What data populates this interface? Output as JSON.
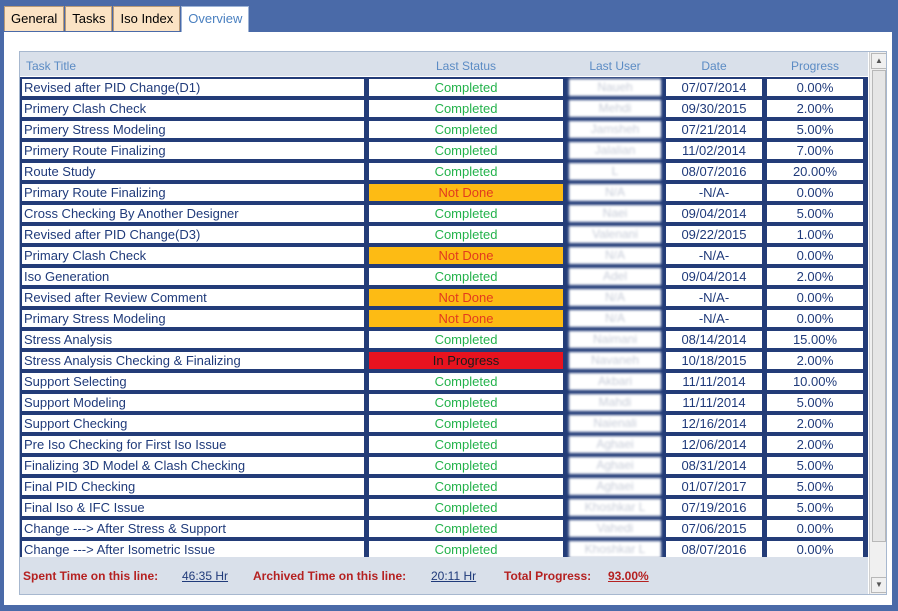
{
  "tabs": [
    {
      "label": "General"
    },
    {
      "label": "Tasks"
    },
    {
      "label": "Iso Index"
    },
    {
      "label": "Overview"
    }
  ],
  "columns": [
    "Task Title",
    "Last Status",
    "Last User",
    "Date",
    "Progress"
  ],
  "rows": [
    {
      "title": "Revised after PID Change(D1)",
      "status": "Completed",
      "status_type": "completed",
      "user": "Naueh",
      "date": "07/07/2014",
      "progress": "0.00%"
    },
    {
      "title": "Primery Clash Check",
      "status": "Completed",
      "status_type": "completed",
      "user": "Mehdi",
      "date": "09/30/2015",
      "progress": "2.00%"
    },
    {
      "title": "Primery Stress Modeling",
      "status": "Completed",
      "status_type": "completed",
      "user": "Jamsheh",
      "date": "07/21/2014",
      "progress": "5.00%"
    },
    {
      "title": "Primery Route Finalizing",
      "status": "Completed",
      "status_type": "completed",
      "user": "Jalalian",
      "date": "11/02/2014",
      "progress": "7.00%"
    },
    {
      "title": "Route Study",
      "status": "Completed",
      "status_type": "completed",
      "user": "L",
      "date": "08/07/2016",
      "progress": "20.00%"
    },
    {
      "title": "Primary Route Finalizing",
      "status": "Not Done",
      "status_type": "notdone",
      "user": "N/A",
      "date": "-N/A-",
      "progress": "0.00%"
    },
    {
      "title": "Cross Checking By Another Designer",
      "status": "Completed",
      "status_type": "completed",
      "user": "Naei",
      "date": "09/04/2014",
      "progress": "5.00%"
    },
    {
      "title": "Revised after PID Change(D3)",
      "status": "Completed",
      "status_type": "completed",
      "user": "Valenani",
      "date": "09/22/2015",
      "progress": "1.00%"
    },
    {
      "title": "Primary Clash Check",
      "status": "Not Done",
      "status_type": "notdone",
      "user": "N/A",
      "date": "-N/A-",
      "progress": "0.00%"
    },
    {
      "title": "Iso Generation",
      "status": "Completed",
      "status_type": "completed",
      "user": "Adel",
      "date": "09/04/2014",
      "progress": "2.00%"
    },
    {
      "title": "Revised after Review Comment",
      "status": "Not Done",
      "status_type": "notdone",
      "user": "N/A",
      "date": "-N/A-",
      "progress": "0.00%"
    },
    {
      "title": "Primary Stress Modeling",
      "status": "Not Done",
      "status_type": "notdone",
      "user": "N/A",
      "date": "-N/A-",
      "progress": "0.00%"
    },
    {
      "title": "Stress Analysis",
      "status": "Completed",
      "status_type": "completed",
      "user": "Naimani",
      "date": "08/14/2014",
      "progress": "15.00%"
    },
    {
      "title": "Stress Analysis Checking & Finalizing",
      "status": "In Progress",
      "status_type": "inprogress",
      "user": "Navaneh",
      "date": "10/18/2015",
      "progress": "2.00%"
    },
    {
      "title": "Support Selecting",
      "status": "Completed",
      "status_type": "completed",
      "user": "Akbari",
      "date": "11/11/2014",
      "progress": "10.00%"
    },
    {
      "title": "Support Modeling",
      "status": "Completed",
      "status_type": "completed",
      "user": "Mahdi",
      "date": "11/11/2014",
      "progress": "5.00%"
    },
    {
      "title": "Support Checking",
      "status": "Completed",
      "status_type": "completed",
      "user": "Naienali",
      "date": "12/16/2014",
      "progress": "2.00%"
    },
    {
      "title": "Pre Iso Checking for First Iso Issue",
      "status": "Completed",
      "status_type": "completed",
      "user": "Aghaei",
      "date": "12/06/2014",
      "progress": "2.00%"
    },
    {
      "title": "Finalizing 3D Model & Clash Checking",
      "status": "Completed",
      "status_type": "completed",
      "user": "Aghaei",
      "date": "08/31/2014",
      "progress": "5.00%"
    },
    {
      "title": "Final PID Checking",
      "status": "Completed",
      "status_type": "completed",
      "user": "Aghaei",
      "date": "01/07/2017",
      "progress": "5.00%"
    },
    {
      "title": "Final Iso & IFC Issue",
      "status": "Completed",
      "status_type": "completed",
      "user": "Khoshkar L",
      "date": "07/19/2016",
      "progress": "5.00%"
    },
    {
      "title": "Change ---> After Stress & Support",
      "status": "Completed",
      "status_type": "completed",
      "user": "Vahedi",
      "date": "07/06/2015",
      "progress": "0.00%"
    },
    {
      "title": "Change ---> After Isometric Issue",
      "status": "Completed",
      "status_type": "completed",
      "user": "Khoshkar L",
      "date": "08/07/2016",
      "progress": "0.00%"
    }
  ],
  "footer": {
    "spent_label": "Spent Time on this line:",
    "spent_value": "46:35 Hr",
    "archived_label": "Archived Time on this line:",
    "archived_value": "20:11 Hr",
    "progress_label": "Total Progress:",
    "progress_value": "93.00%"
  },
  "icons": {
    "scroll_up": "arrow-up-icon",
    "scroll_down": "arrow-down-icon"
  },
  "colors": {
    "completed": "#23b24b",
    "not_done_bg": "#fdbb14",
    "in_progress_bg": "#e8131f",
    "row_border": "#233c78"
  }
}
